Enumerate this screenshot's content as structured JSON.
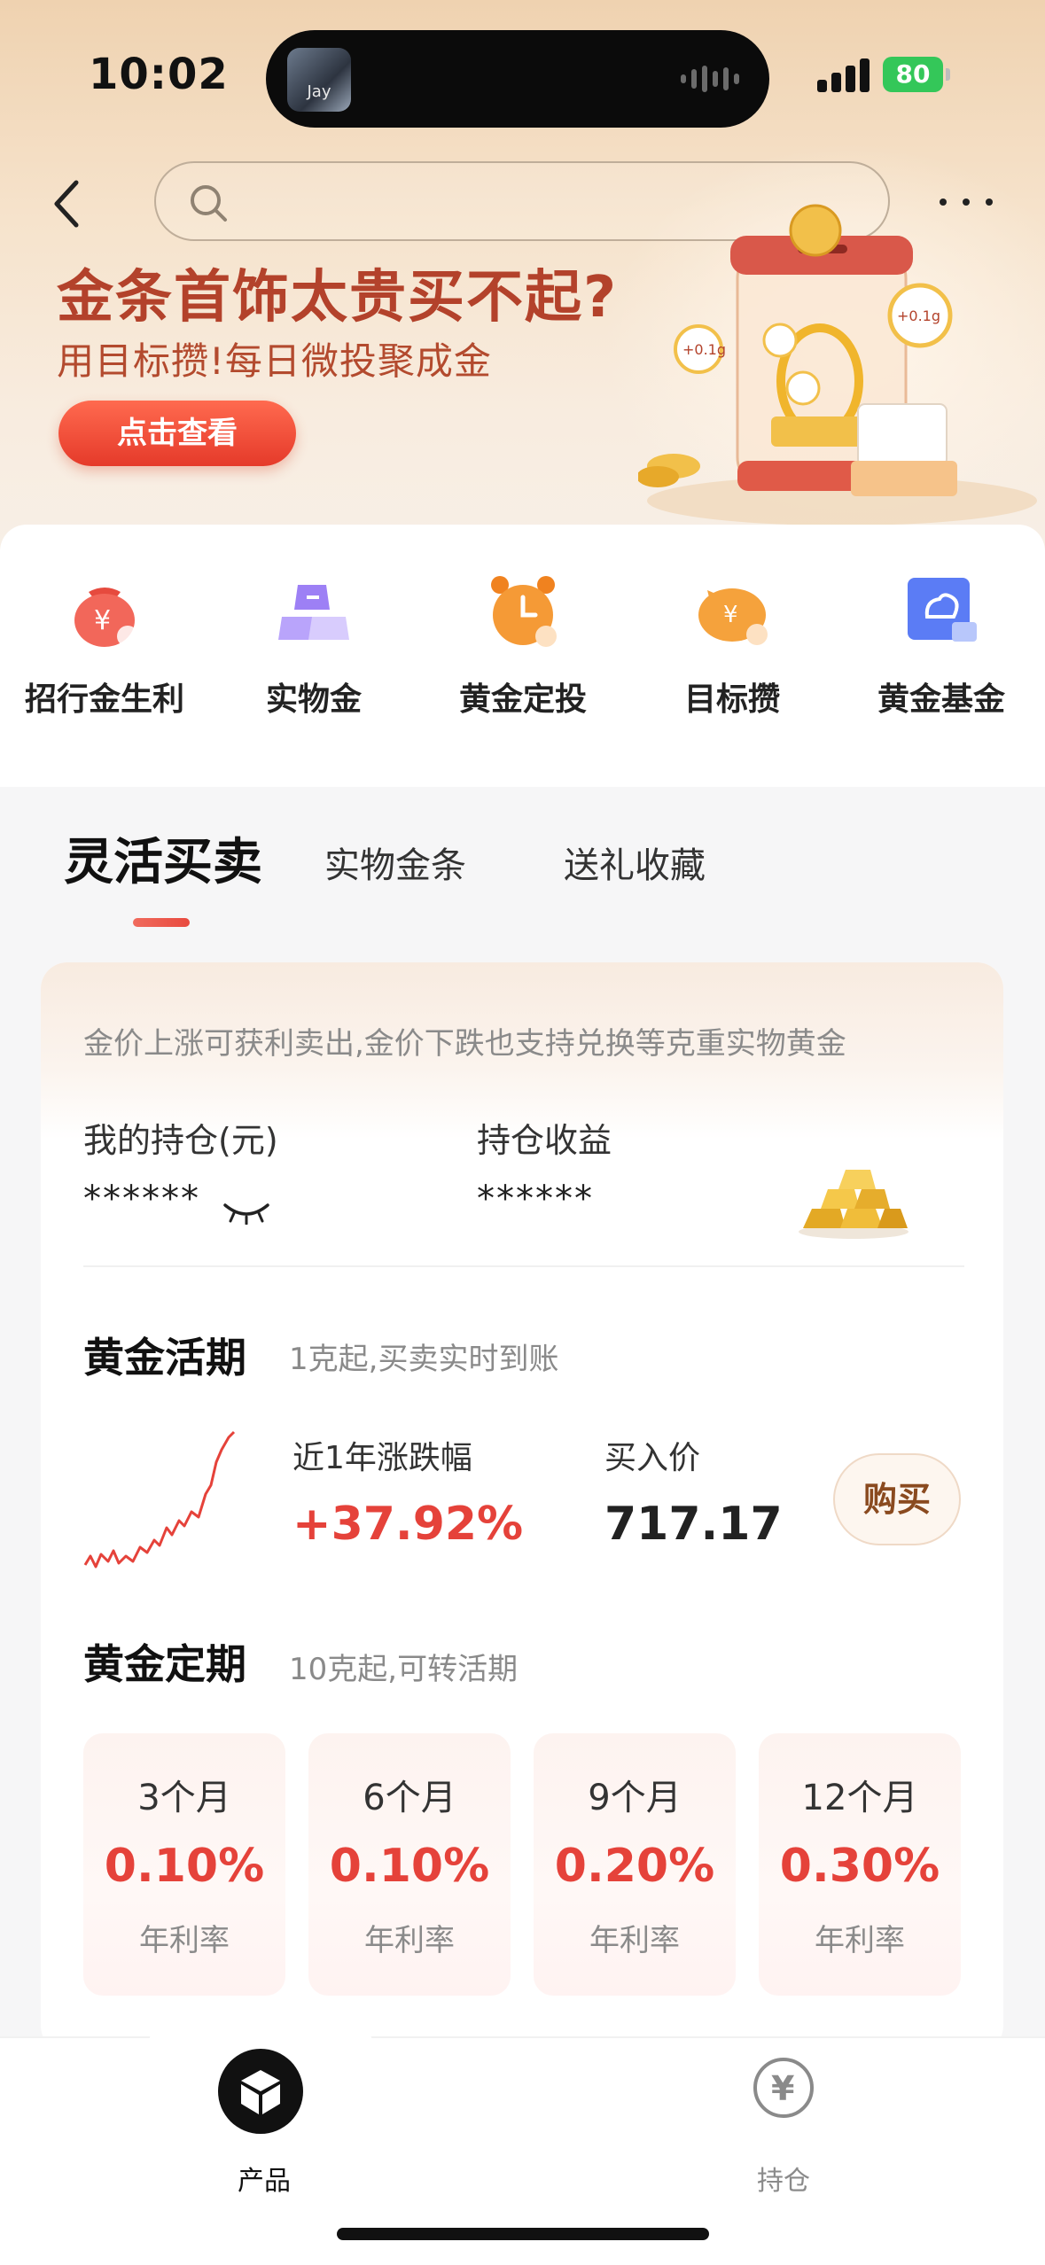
{
  "status_bar": {
    "time": "10:02",
    "battery": "80",
    "island_avatar_text": "Jay"
  },
  "header": {
    "search_placeholder": "",
    "back_icon": "chevron-left-icon",
    "more_icon": "ellipsis-icon"
  },
  "banner": {
    "title": "金条首饰太贵买不起?",
    "subtitle": "用目标攒!每日微投聚成金",
    "cta": "点击查看",
    "art_badges": [
      "+0.1g",
      "+0.1g",
      "+0.1g",
      "+0.1g"
    ]
  },
  "categories": [
    {
      "label": "招行金生利",
      "icon": "money-bag-icon",
      "color": "#ef5a4e"
    },
    {
      "label": "实物金",
      "icon": "gold-bar-icon",
      "color": "#8a6cf0"
    },
    {
      "label": "黄金定投",
      "icon": "alarm-clock-icon",
      "color": "#f28a2e"
    },
    {
      "label": "目标攒",
      "icon": "piggy-bank-icon",
      "color": "#f39a3a"
    },
    {
      "label": "黄金基金",
      "icon": "fund-box-icon",
      "color": "#4f73f0"
    }
  ],
  "tabs": [
    {
      "label": "灵活买卖",
      "active": true
    },
    {
      "label": "实物金条",
      "active": false
    },
    {
      "label": "送礼收藏",
      "active": false
    }
  ],
  "card": {
    "description": "金价上涨可获利卖出,金价下跌也支持兑换等克重实物黄金",
    "holdings": {
      "my_position_label": "我的持仓(元)",
      "my_position_value": "******",
      "profit_label": "持仓收益",
      "profit_value": "******"
    },
    "current": {
      "title": "黄金活期",
      "subtitle": "1克起,买卖实时到账",
      "change_label": "近1年涨跌幅",
      "change_value": "+37.92%",
      "price_label": "买入价",
      "price_value": "717.17",
      "buy_label": "购买"
    },
    "fixed": {
      "title": "黄金定期",
      "subtitle": "10克起,可转活期",
      "terms": [
        {
          "period": "3个月",
          "rate": "0.10%",
          "rate_label": "年利率"
        },
        {
          "period": "6个月",
          "rate": "0.10%",
          "rate_label": "年利率"
        },
        {
          "period": "9个月",
          "rate": "0.20%",
          "rate_label": "年利率"
        },
        {
          "period": "12个月",
          "rate": "0.30%",
          "rate_label": "年利率"
        }
      ]
    }
  },
  "tabbar": {
    "items": [
      {
        "label": "产品",
        "icon": "cube-icon",
        "active": true
      },
      {
        "label": "持仓",
        "icon": "yuan-circle-icon",
        "active": false
      }
    ]
  },
  "colors": {
    "accent_red": "#e5423a",
    "banner_title": "#b3422b",
    "cta_red": "#e53a2a"
  }
}
